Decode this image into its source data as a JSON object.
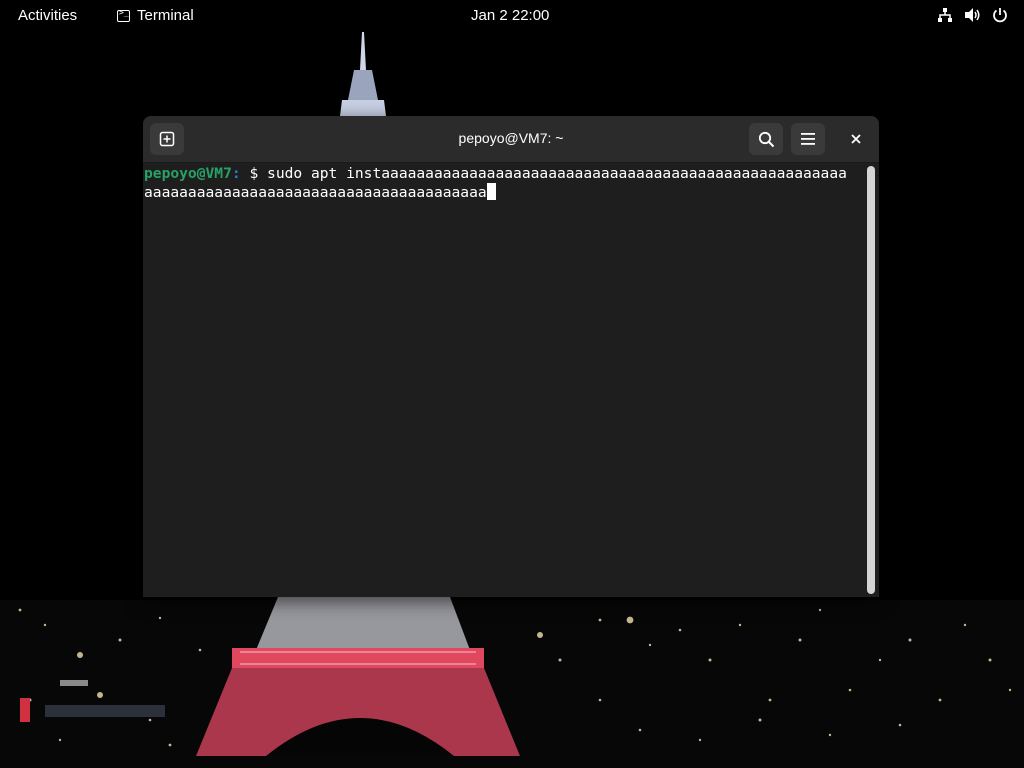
{
  "topbar": {
    "activities": "Activities",
    "app_name": "Terminal",
    "app_icon": "terminal-icon",
    "clock": "Jan 2  22:00",
    "tray_icons": [
      "network-wired-icon",
      "volume-icon",
      "power-icon"
    ]
  },
  "window": {
    "title": "pepoyo@VM7: ~",
    "buttons": {
      "new_tab": "new-tab-icon",
      "search": "search-icon",
      "menu": "hamburger-menu-icon",
      "close": "close-icon"
    }
  },
  "terminal": {
    "prompt_user": "pepoyo@VM7",
    "prompt_colon": ":",
    "prompt_rest": " $ ",
    "command_line1": "sudo apt instaaaaaaaaaaaaaaaaaaaaaaaaaaaaaaaaaaaaaaaaaaaaaaaaaaaaa",
    "command_line2": "aaaaaaaaaaaaaaaaaaaaaaaaaaaaaaaaaaaaaaa"
  },
  "colors": {
    "prompt_user": "#26a269",
    "prompt_path": "#2a7bde",
    "terminal_bg": "#1e1e1e",
    "headerbar_bg": "#2b2b2b"
  }
}
